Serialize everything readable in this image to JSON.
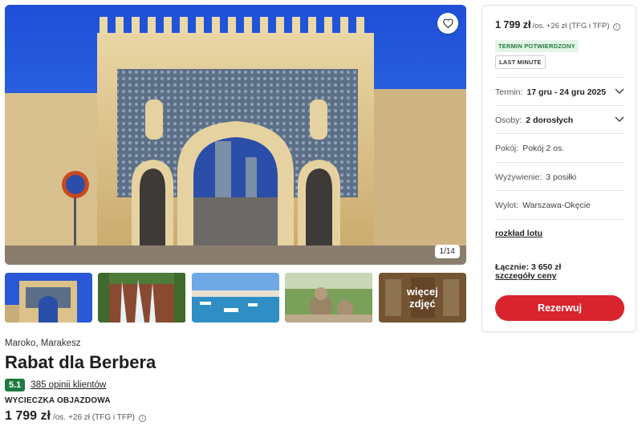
{
  "gallery": {
    "counter": "1/14",
    "more_label": "więcej zdjęć",
    "favorite_icon": "heart-icon"
  },
  "offer": {
    "location": "Maroko, Marakesz",
    "title": "Rabat dla Berbera",
    "rating": "5.1",
    "reviews": "385 opinii klientów",
    "trip_type": "WYCIECZKA OBJAZDOWA",
    "price": "1 799 zł",
    "price_suffix": "/os.",
    "price_extra": "+26 zł (TFG i TFP)"
  },
  "sidebar": {
    "price": "1 799 zł",
    "price_suffix": "/os.",
    "price_extra": "+26 zł (TFG i TFP)",
    "tag_confirmed": "TERMIN POTWIERDZONY",
    "tag_last_minute": "LAST MINUTE",
    "term_label": "Termin:",
    "term_value": "17 gru - 24 gru 2025",
    "persons_label": "Osoby:",
    "persons_value": "2 dorosłych",
    "room_label": "Pokój:",
    "room_value": "Pokój 2 os.",
    "meals_label": "Wyżywienie:",
    "meals_value": "3 posiłki",
    "departure_label": "Wylot:",
    "departure_value": "Warszawa-Okęcie",
    "flight_schedule_link": "rozkład lotu",
    "total_label": "Łącznie:",
    "total_value": "3 650 zł",
    "price_details_link": "szczegóły ceny",
    "reserve_button": "Rezerwuj"
  },
  "colors": {
    "accent_red": "#d9232d",
    "rating_green": "#1f7a3e",
    "tag_green_bg": "#e3f5e6"
  }
}
